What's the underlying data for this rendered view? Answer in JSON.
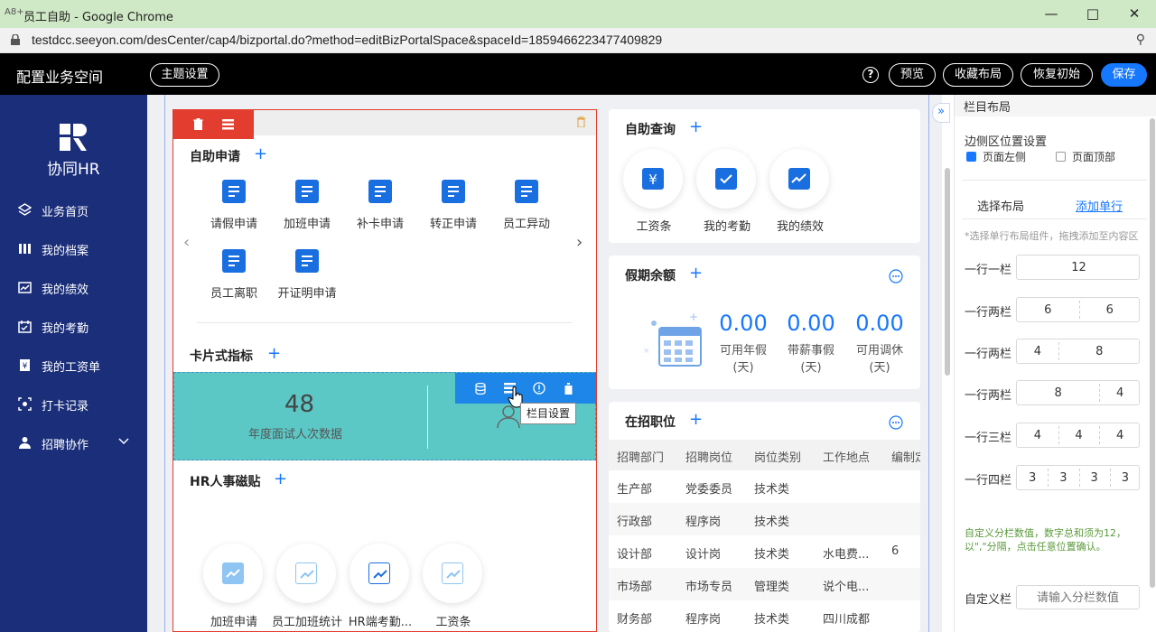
{
  "browser": {
    "window_title": "员工自助 - Google Chrome",
    "url": "testdcc.seeyon.com/desCenter/cap4/bizportal.do?method=editBizPortalSpace&spaceId=1859466223477409829"
  },
  "header": {
    "title": "配置业务空间",
    "theme_button": "主题设置",
    "help": "?",
    "preview": "预览",
    "collect_layout": "收藏布局",
    "restore": "恢复初始",
    "save": "保存"
  },
  "sidebar": {
    "brand": "协同HR",
    "items": [
      {
        "label": "业务首页",
        "icon": "layers-icon"
      },
      {
        "label": "我的档案",
        "icon": "files-icon"
      },
      {
        "label": "我的绩效",
        "icon": "chart-icon"
      },
      {
        "label": "我的考勤",
        "icon": "calendar-icon"
      },
      {
        "label": "我的工资单",
        "icon": "salary-icon"
      },
      {
        "label": "打卡记录",
        "icon": "clock-icon"
      },
      {
        "label": "招聘协作",
        "icon": "recruit-icon"
      }
    ]
  },
  "self_apply": {
    "title": "自助申请",
    "apps": [
      "请假申请",
      "加班申请",
      "补卡申请",
      "转正申请",
      "员工异动",
      "员工离职",
      "开证明申请"
    ]
  },
  "card_index": {
    "title": "卡片式指标",
    "value": "48",
    "label": "年度面试人次数据",
    "tooltip": "栏目设置"
  },
  "hr_sticker": {
    "title": "HR人事磁贴",
    "items": [
      "加班申请",
      "员工加班统计",
      "HR端考勤...",
      "工资条"
    ]
  },
  "self_query": {
    "title": "自助查询",
    "items": [
      "工资条",
      "我的考勤",
      "我的绩效"
    ]
  },
  "holiday": {
    "title": "假期余额",
    "items": [
      {
        "value": "0.00",
        "label": "可用年假",
        "unit": "(天)"
      },
      {
        "value": "0.00",
        "label": "带薪事假",
        "unit": "(天)"
      },
      {
        "value": "0.00",
        "label": "可用调休",
        "unit": "(天)"
      }
    ]
  },
  "jobs": {
    "title": "在招职位",
    "columns": [
      "招聘部门",
      "招聘岗位",
      "岗位类别",
      "工作地点",
      "编制定"
    ],
    "rows": [
      [
        "生产部",
        "党委委员",
        "技术类",
        "",
        ""
      ],
      [
        "行政部",
        "程序岗",
        "技术类",
        "",
        ""
      ],
      [
        "设计部",
        "设计岗",
        "技术类",
        "水电费...",
        "6"
      ],
      [
        "市场部",
        "市场专员",
        "管理类",
        "说个电...",
        ""
      ],
      [
        "财务部",
        "程序岗",
        "技术类",
        "四川成都",
        ""
      ]
    ]
  },
  "layout_panel": {
    "header": "栏目布局",
    "side_position_title": "边侧区位置设置",
    "opt_left": "页面左侧",
    "opt_top": "页面顶部",
    "tab_choose": "选择布局",
    "tab_add": "添加单行",
    "hint": "*选择单行布局组件，拖拽添加至内容区",
    "rows": [
      {
        "label": "一行一栏",
        "cols": [
          "12"
        ]
      },
      {
        "label": "一行两栏",
        "cols": [
          "6",
          "6"
        ]
      },
      {
        "label": "一行两栏",
        "cols": [
          "4",
          "8"
        ]
      },
      {
        "label": "一行两栏",
        "cols": [
          "8",
          "4"
        ]
      },
      {
        "label": "一行三栏",
        "cols": [
          "4",
          "4",
          "4"
        ]
      },
      {
        "label": "一行四栏",
        "cols": [
          "3",
          "3",
          "3",
          "3"
        ]
      }
    ],
    "custom_hint": "自定义分栏数值，数字总和须为12，以\",\"分隔，点击任意位置确认。",
    "custom_label": "自定义栏",
    "custom_placeholder": "请输入分栏数值"
  }
}
